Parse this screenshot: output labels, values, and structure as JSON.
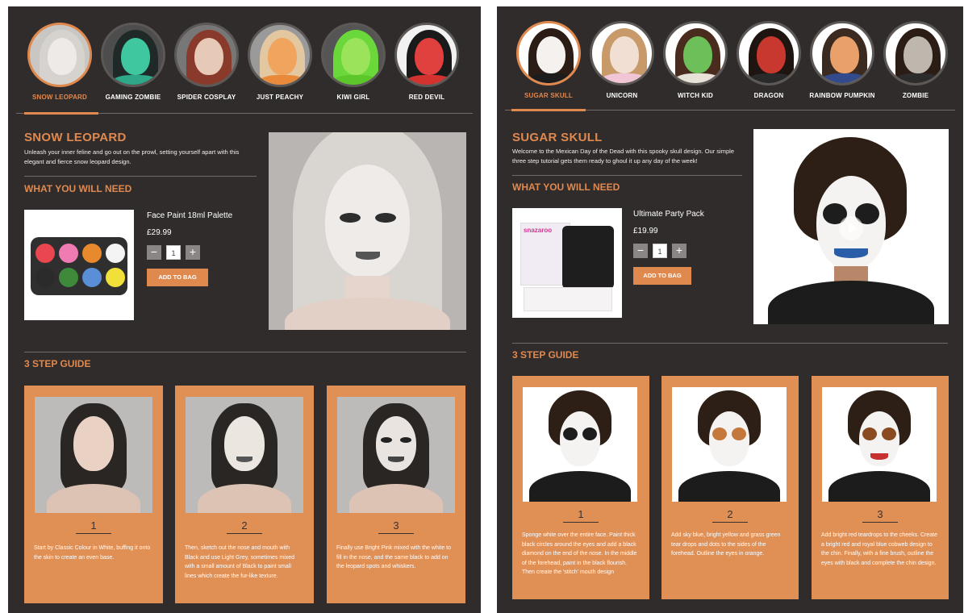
{
  "left": {
    "nav": [
      {
        "label": "SNOW LEOPARD",
        "active": true
      },
      {
        "label": "GAMING ZOMBIE",
        "active": false
      },
      {
        "label": "SPIDER COSPLAY",
        "active": false
      },
      {
        "label": "JUST PEACHY",
        "active": false
      },
      {
        "label": "KIWI GIRL",
        "active": false
      },
      {
        "label": "RED DEVIL",
        "active": false
      }
    ],
    "title": "SNOW LEOPARD",
    "intro": "Unleash your inner feline and go out on the prowl, setting yourself apart with this elegant and fierce snow leopard design.",
    "need_heading": "WHAT YOU WILL NEED",
    "product": {
      "name": "Face Paint 18ml Palette",
      "price": "£29.99",
      "qty": "1",
      "minus": "−",
      "plus": "+",
      "add_label": "ADD TO BAG"
    },
    "guide_heading": "3 STEP GUIDE",
    "steps": [
      {
        "num": "1",
        "text": "Start by Classic Colour in White, buffing it onto the skin to create an even base."
      },
      {
        "num": "2",
        "text": "Then, sketch out the nose and mouth with Black and use Light Grey, sometimes mixed with a small amount of Black to paint small lines which create the fur-like texture."
      },
      {
        "num": "3",
        "text": "Finally use Bright Pink mixed with the white to fill in the nose, and the same black to add on the leopard spots and whiskers."
      }
    ]
  },
  "right": {
    "nav": [
      {
        "label": "SUGAR SKULL",
        "active": true
      },
      {
        "label": "UNICORN",
        "active": false
      },
      {
        "label": "WITCH KID",
        "active": false
      },
      {
        "label": "DRAGON",
        "active": false
      },
      {
        "label": "RAINBOW PUMPKIN",
        "active": false
      },
      {
        "label": "ZOMBIE",
        "active": false
      }
    ],
    "title": "SUGAR SKULL",
    "intro": "Welcome to the Mexican Day of the Dead with this spooky skull design. Our simple three step tutorial gets them ready to ghoul it up any day of the week!",
    "need_heading": "WHAT YOU WILL NEED",
    "product": {
      "name": "Ultimate Party Pack",
      "price": "£19.99",
      "qty": "1",
      "minus": "−",
      "plus": "+",
      "add_label": "ADD TO BAG",
      "brand": "snazaroo"
    },
    "guide_heading": "3 STEP GUIDE",
    "steps": [
      {
        "num": "1",
        "text": "Sponge white over the entire face. Paint thick black circles around the eyes and add a black diamond on the end of the nose. In the middle of the forehead, paint in the black flourish. Then create the 'stitch' mouth design"
      },
      {
        "num": "2",
        "text": "Add sky blue, bright yellow and grass green tear drops and dots to the sides of the forehead. Outline the eyes in orange."
      },
      {
        "num": "3",
        "text": "Add bright red teardrops to the cheeks. Create a bright red and royal blue cobweb design to the chin. Finally, with a fine brush, outline the eyes with black and complete the chin design."
      }
    ]
  },
  "colors": {
    "accent": "#e0894f",
    "panel": "#302c2b",
    "step_card": "#e08f55"
  },
  "palette_colors": [
    "#e9464f",
    "#f07bb3",
    "#e8892d",
    "#f4f4f4",
    "#2b2b2b",
    "#3e8a3a",
    "#5a8ed6",
    "#f2e03a"
  ]
}
